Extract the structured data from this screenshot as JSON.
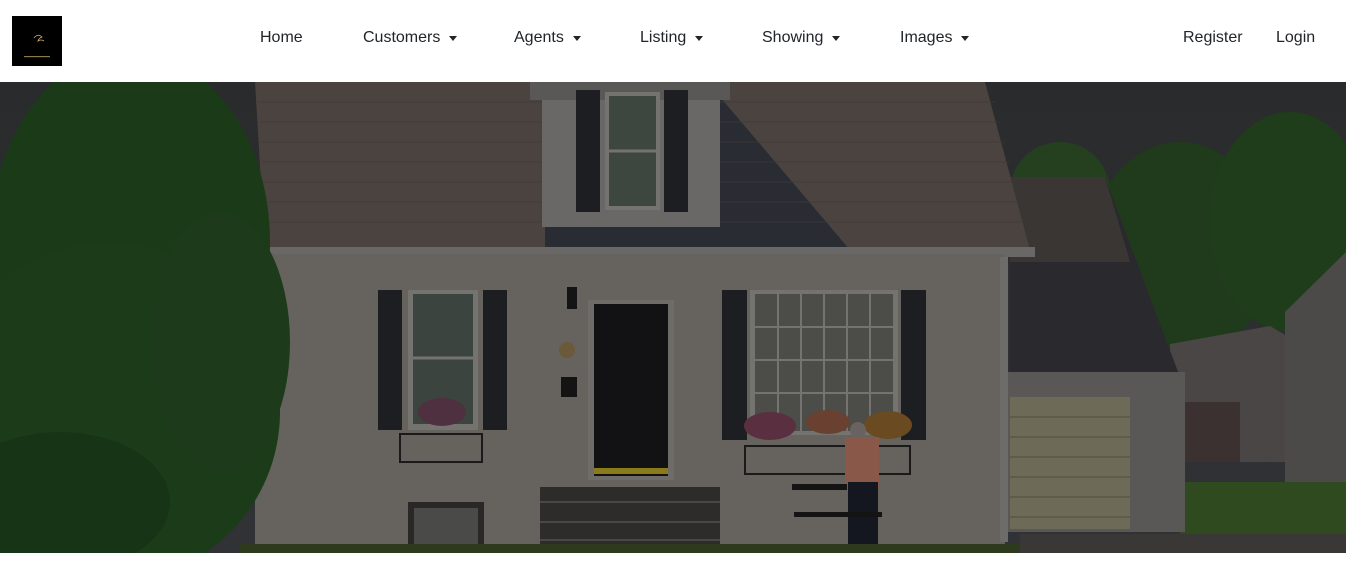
{
  "logo": {
    "alt": "site-logo"
  },
  "nav": {
    "items": [
      {
        "label": "Home",
        "dropdown": false
      },
      {
        "label": "Customers",
        "dropdown": true
      },
      {
        "label": "Agents",
        "dropdown": true
      },
      {
        "label": "Listing",
        "dropdown": true
      },
      {
        "label": "Showing",
        "dropdown": true
      },
      {
        "label": "Images",
        "dropdown": true
      }
    ],
    "auth": {
      "register": "Register",
      "login": "Login"
    }
  },
  "hero": {
    "image": "house-exterior-photo"
  },
  "colors": {
    "nav_bg": "#ffffff",
    "nav_text": "#212529",
    "hero_overlay": "#000000"
  }
}
